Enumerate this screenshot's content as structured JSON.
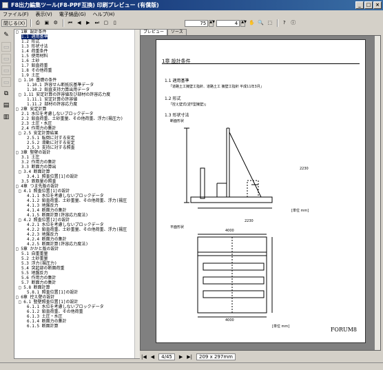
{
  "title": "F8出力編集ツール(F8-PPF互換) 印刷プレビュー (有償版)",
  "menu": [
    "ファイル(F)",
    "表示(V)",
    "電子納品(G)",
    "ヘルプ(H)"
  ],
  "toolbar": {
    "close_label": "閉じる(X)",
    "zoom": "75",
    "page_count": "4"
  },
  "tree": [
    {
      "t": "□ 1章 設計条件",
      "sel": false,
      "d": 0
    },
    {
      "t": "1.1 適用基準",
      "sel": true,
      "d": 2
    },
    {
      "t": "1.2 形式",
      "sel": false,
      "d": 2
    },
    {
      "t": "1.3 形状寸法",
      "sel": false,
      "d": 2
    },
    {
      "t": "1.4 荷重条件",
      "sel": false,
      "d": 2
    },
    {
      "t": "1.5 使用材料",
      "sel": false,
      "d": 2
    },
    {
      "t": "1.6 土砂",
      "sel": false,
      "d": 2
    },
    {
      "t": "1.7 鉛直荷重",
      "sel": false,
      "d": 2
    },
    {
      "t": "1.8 その他荷重",
      "sel": false,
      "d": 2
    },
    {
      "t": "1.9 土圧",
      "sel": false,
      "d": 2
    },
    {
      "t": "□ 1.10 基礎の条件",
      "sel": false,
      "d": 1
    },
    {
      "t": "1.10.1 許容せん断抵抗基準データ",
      "sel": false,
      "d": 4
    },
    {
      "t": "1.10.2 鉛直支持力算出用データ",
      "sel": false,
      "d": 4
    },
    {
      "t": "□ 1.11 安定計算の許容値及び部材の許容応力度",
      "sel": false,
      "d": 1
    },
    {
      "t": "1.11.1 安定計算の許容値",
      "sel": false,
      "d": 4
    },
    {
      "t": "1.11.2 部材の許容応力度",
      "sel": false,
      "d": 4
    },
    {
      "t": "□ 2章 安定計算",
      "sel": false,
      "d": 0
    },
    {
      "t": "2.1 水位を考慮しないブロックデータ",
      "sel": false,
      "d": 2
    },
    {
      "t": "2.2 鉛直荷重、土砂重量、その他荷重、浮力(揚圧力)",
      "sel": false,
      "d": 2
    },
    {
      "t": "2.3 土圧・水圧",
      "sel": false,
      "d": 2
    },
    {
      "t": "2.4 作用力の集計",
      "sel": false,
      "d": 2
    },
    {
      "t": "□ 2.5 安定計算結果",
      "sel": false,
      "d": 1
    },
    {
      "t": "2.5.1 転倒に対する安定",
      "sel": false,
      "d": 4
    },
    {
      "t": "2.5.2 滑動に対する安定",
      "sel": false,
      "d": 4
    },
    {
      "t": "2.5.3 支持に対する照査",
      "sel": false,
      "d": 4
    },
    {
      "t": "□ 3章 竪壁の設計",
      "sel": false,
      "d": 0
    },
    {
      "t": "3.1 土圧",
      "sel": false,
      "d": 2
    },
    {
      "t": "3.2 作用力の集計",
      "sel": false,
      "d": 2
    },
    {
      "t": "3.3 断面力の算出",
      "sel": false,
      "d": 2
    },
    {
      "t": "□ 3.4 断面計算",
      "sel": false,
      "d": 1
    },
    {
      "t": "3.4.1 照査位置[1]の設計",
      "sel": false,
      "d": 4
    },
    {
      "t": "3.5 鉄筋量の照査",
      "sel": false,
      "d": 2
    },
    {
      "t": "□ 4章 つま先版の設計",
      "sel": false,
      "d": 0
    },
    {
      "t": "□ 4.1 照査位置[1]の設計",
      "sel": false,
      "d": 1
    },
    {
      "t": "4.1.1 水位を考慮しないブロックデータ",
      "sel": false,
      "d": 4
    },
    {
      "t": "4.1.2 鉛直荷重、土砂重量、その他荷重、浮力(揚圧",
      "sel": false,
      "d": 4
    },
    {
      "t": "4.1.3 地盤反力",
      "sel": false,
      "d": 4
    },
    {
      "t": "4.1.4 断面力の集計",
      "sel": false,
      "d": 4
    },
    {
      "t": "4.1.5 断面計算(許容応力度法)",
      "sel": false,
      "d": 4
    },
    {
      "t": "□ 4.2 照査位置[2]の設計",
      "sel": false,
      "d": 1
    },
    {
      "t": "4.2.1 水位を考慮しないブロックデータ",
      "sel": false,
      "d": 4
    },
    {
      "t": "4.2.2 鉛直荷重、土砂重量、その他荷重、浮力(揚圧",
      "sel": false,
      "d": 4
    },
    {
      "t": "4.2.3 地盤反力",
      "sel": false,
      "d": 4
    },
    {
      "t": "4.2.4 断面力の集計",
      "sel": false,
      "d": 4
    },
    {
      "t": "4.2.5 断面計算(許容応力度法)",
      "sel": false,
      "d": 4
    },
    {
      "t": "□ 5章 かかと版の設計",
      "sel": false,
      "d": 0
    },
    {
      "t": "5.1 自重重量",
      "sel": false,
      "d": 2
    },
    {
      "t": "5.2 土砂重量",
      "sel": false,
      "d": 2
    },
    {
      "t": "5.3 浮力(揚圧力)",
      "sel": false,
      "d": 2
    },
    {
      "t": "5.4 突起部の断面荷重",
      "sel": false,
      "d": 2
    },
    {
      "t": "5.5 地盤反力",
      "sel": false,
      "d": 2
    },
    {
      "t": "5.6 作用力の集計",
      "sel": false,
      "d": 2
    },
    {
      "t": "5.7 断面力の集計",
      "sel": false,
      "d": 2
    },
    {
      "t": "□ 5.8 断面計算",
      "sel": false,
      "d": 1
    },
    {
      "t": "5.8.1 照査位置[1]の設計",
      "sel": false,
      "d": 4
    },
    {
      "t": "□ 6章 控え壁の設計",
      "sel": false,
      "d": 0
    },
    {
      "t": "□ 6.1 竪壁照査位置[1]の設計",
      "sel": false,
      "d": 1
    },
    {
      "t": "6.1.1 水位を考慮しないブロックデータ",
      "sel": false,
      "d": 4
    },
    {
      "t": "6.1.2 鉛直荷重、その他荷重",
      "sel": false,
      "d": 4
    },
    {
      "t": "6.1.3 土圧・水圧",
      "sel": false,
      "d": 4
    },
    {
      "t": "6.1.4 断面力の集計",
      "sel": false,
      "d": 4
    },
    {
      "t": "6.1.5 断面計算",
      "sel": false,
      "d": 4
    }
  ],
  "tabs": [
    "プレビュー",
    "ソース"
  ],
  "page": {
    "chapter": "1章  設計条件",
    "s1": "1.1 適用基準",
    "s1_body": "「道路土工擁壁工指針、道路土工 擁壁工指針  平成11年3月」",
    "s2": "1.2 形式",
    "s2_body": "「控え壁式(逆T型擁壁)」",
    "s3": "1.3 形状寸法",
    "s3_sub1": "断面形状",
    "s3_sub2": "平面形状",
    "unit": "[単位 mm]",
    "dim1": "2230",
    "dim2": "2230",
    "dim3": "4000",
    "dim4": "4000",
    "watermark": "FORUM8"
  },
  "nav": {
    "page": "4/45",
    "size": "209 x 297mm"
  }
}
